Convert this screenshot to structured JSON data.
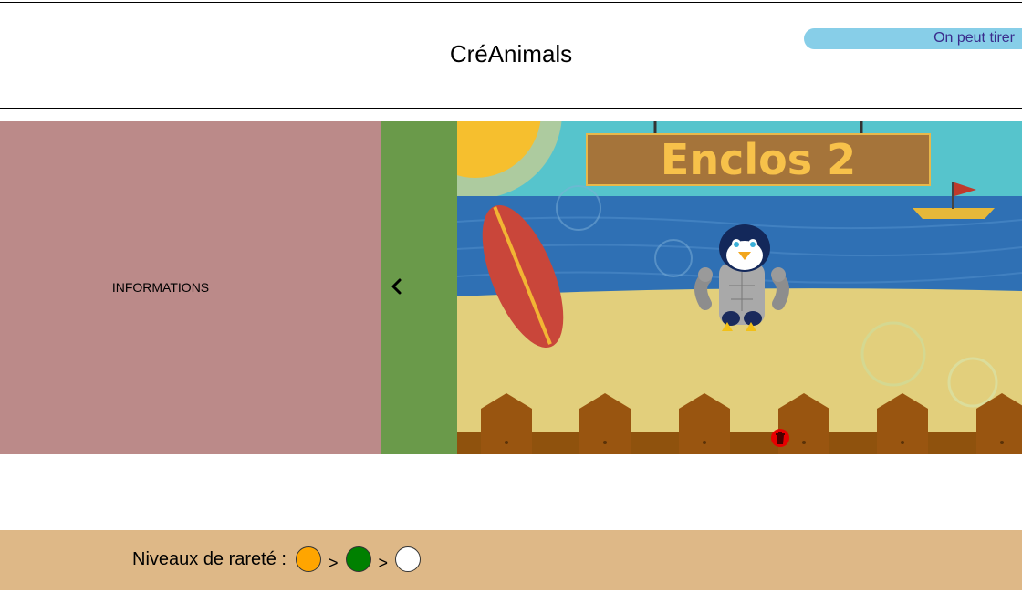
{
  "app": {
    "title": "CréAnimals"
  },
  "header": {
    "draw_status": "On peut tirer"
  },
  "sidebar": {
    "label": "INFORMATIONS",
    "collapse_icon": "chevron-left-icon"
  },
  "enclosure": {
    "sign_text": "Enclos 2",
    "animal": "penguin",
    "delete_icon": "trash-icon",
    "delete_color": "#e60000"
  },
  "footer": {
    "rarity_label": "Niveaux de rareté :",
    "separator": ">",
    "levels": [
      {
        "color": "#ffa500"
      },
      {
        "color": "#008000"
      },
      {
        "color": "#ffffff"
      }
    ]
  }
}
